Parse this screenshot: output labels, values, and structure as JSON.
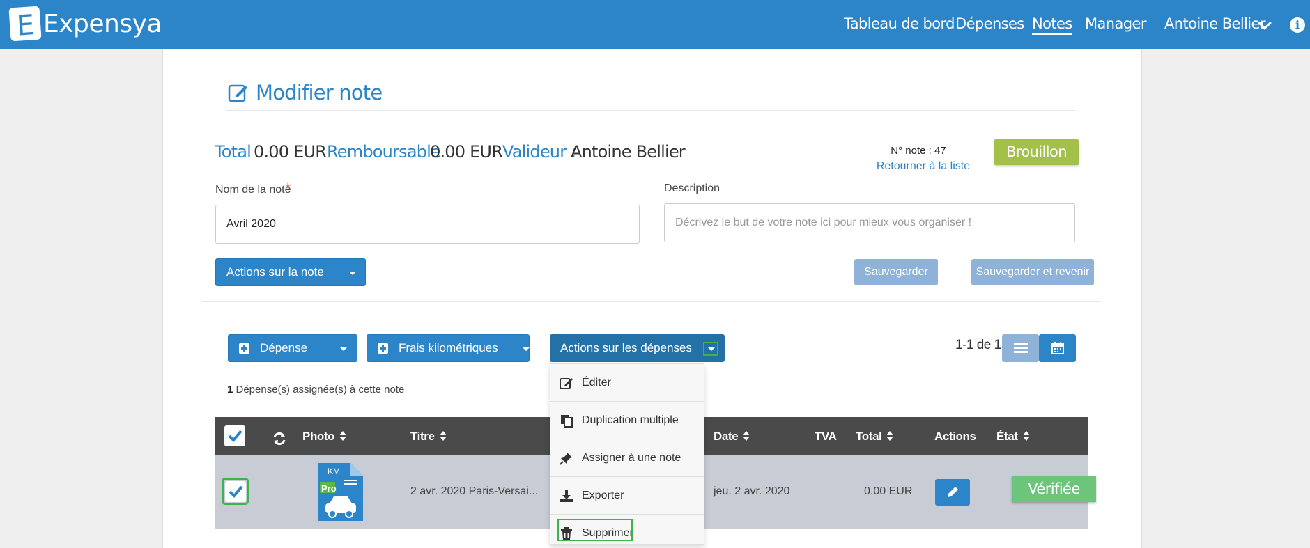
{
  "nav": {
    "logo_letter": "E",
    "brand": "Expensya",
    "items": [
      "Tableau de bord",
      "Dépenses",
      "Notes",
      "Manager"
    ],
    "active": "Notes",
    "user": "Antoine Bellier",
    "info_icon": "info-icon"
  },
  "page": {
    "title": "Modifier note",
    "title_icon": "edit-icon"
  },
  "summary": {
    "total_label": "Total",
    "total_value": "0.00 EUR",
    "refund_label": "Remboursable",
    "refund_value": "0.00 EUR",
    "validator_label": "Valideur :",
    "validator_value": "Antoine Bellier",
    "note_number": "N° note : 47",
    "return_link": "Retourner à la liste",
    "status": "Brouillon"
  },
  "form": {
    "name_label": "Nom de la note",
    "name_required": "*",
    "name_value": "Avril 2020",
    "description_label": "Description",
    "description_placeholder": "Décrivez le but de votre note ici pour mieux vous organiser !",
    "actions_note": "Actions sur la note",
    "save": "Sauvegarder",
    "save_return": "Sauvegarder et revenir"
  },
  "toolbar": {
    "expense": "Dépense",
    "mileage": "Frais kilométriques",
    "expense_actions": "Actions sur les dépenses",
    "pager": "1-1 de 1"
  },
  "assigned": {
    "count": "1",
    "text": " Dépense(s) assignée(s) à cette note"
  },
  "table": {
    "headers": {
      "photo": "Photo",
      "title": "Titre",
      "date": "Date",
      "vat": "TVA",
      "total": "Total",
      "actions": "Actions",
      "state": "État"
    },
    "row": {
      "thumb_top": "KM",
      "thumb_badge": "Pro",
      "title": "2 avr. 2020 Paris-Versai...",
      "date": "jeu. 2 avr. 2020",
      "total": "0.00 EUR",
      "state": "Vérifiée"
    }
  },
  "menu": {
    "items": [
      "Éditer",
      "Duplication multiple",
      "Assigner à une note",
      "Exporter",
      "Supprimer"
    ]
  },
  "colors": {
    "brand": "#2c85c8",
    "draft": "#a3c14a",
    "verified": "#6dc47b",
    "highlight": "#3bb54a"
  }
}
